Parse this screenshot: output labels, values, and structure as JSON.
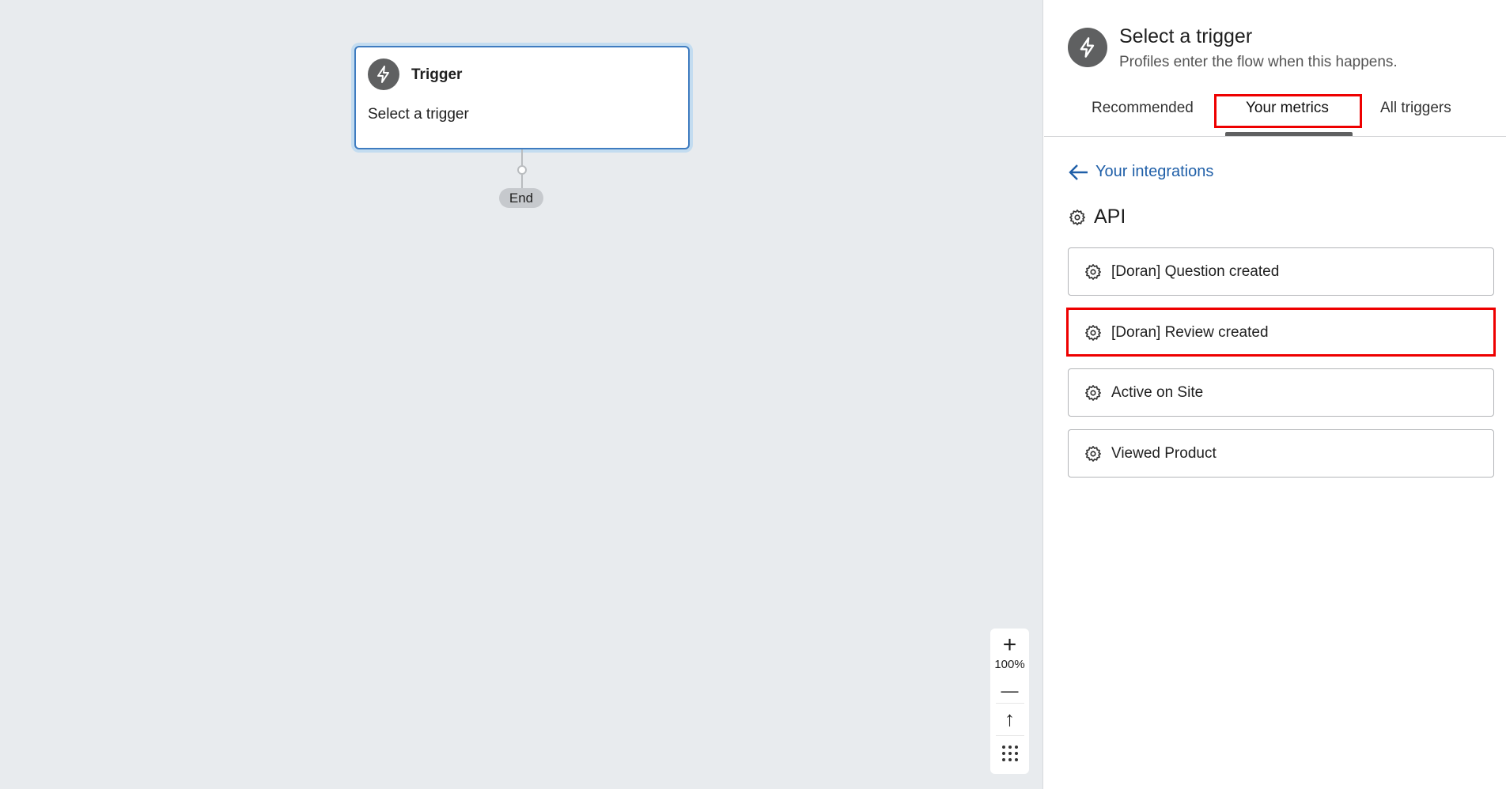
{
  "canvas": {
    "trigger_card": {
      "title": "Trigger",
      "subtitle": "Select a trigger",
      "icon": "lightning-icon"
    },
    "end_label": "End",
    "zoom_controls": {
      "zoom_in": "+",
      "level": "100%",
      "zoom_out": "—",
      "fit": "↑",
      "grid": "⋮⋮⋮"
    }
  },
  "panel": {
    "title": "Select a trigger",
    "subtitle": "Profiles enter the flow when this happens.",
    "icon": "lightning-icon",
    "tabs": [
      {
        "label": "Recommended"
      },
      {
        "label": "Your metrics",
        "active": true
      },
      {
        "label": "All triggers"
      }
    ],
    "back_link": "Your integrations",
    "section": "API",
    "items": [
      {
        "label": "[Doran] Question created"
      },
      {
        "label": "[Doran] Review created",
        "highlighted": true
      },
      {
        "label": "Active on Site"
      },
      {
        "label": "Viewed Product"
      }
    ]
  },
  "colors": {
    "highlight": "#ee0000",
    "link": "#1f5fa8",
    "selected_border": "#3f7cc0"
  }
}
